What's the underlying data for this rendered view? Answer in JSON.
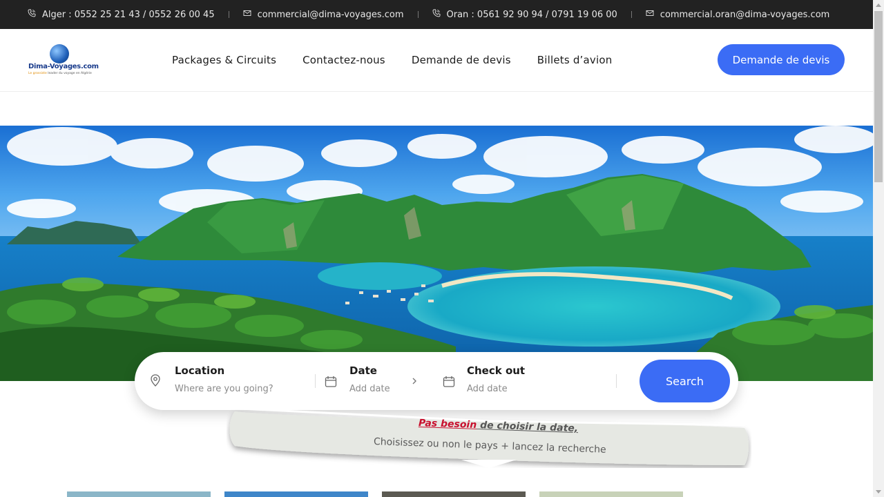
{
  "topbar": {
    "alger_phone": "Alger : 0552 25 21 43 / 0552 26 00 45",
    "email1": "commercial@dima-voyages.com",
    "oran_phone": "Oran : 0561 92 90 94 / 0791 19 06 00",
    "email2": "commercial.oran@dima-voyages.com"
  },
  "logo": {
    "name": "Dima-Voyages.com",
    "tagline_prefix": "Le grossiste",
    "tagline_rest": " leader du voyage en Algérie"
  },
  "nav": {
    "items": [
      "Packages & Circuits",
      "Contactez-nous",
      "Demande de devis",
      "Billets d’avion"
    ],
    "cta": "Demande de devis"
  },
  "search": {
    "location_label": "Location",
    "location_placeholder": "Where are you going?",
    "date_label": "Date",
    "date_placeholder": "Add date",
    "checkout_label": "Check out",
    "checkout_placeholder": "Add date",
    "button": "Search"
  },
  "note": {
    "line1_red": "Pas besoin",
    "line1_rest": " de choisir la date,",
    "line2": "Choisissez ou non le pays + lancez la recherche"
  },
  "colors": {
    "accent": "#3b6cf5",
    "topbar": "#222222",
    "note_red": "#c8102e"
  },
  "icons": [
    "phone-icon",
    "mail-icon",
    "location-pin-icon",
    "calendar-icon",
    "chevron-right-icon"
  ]
}
